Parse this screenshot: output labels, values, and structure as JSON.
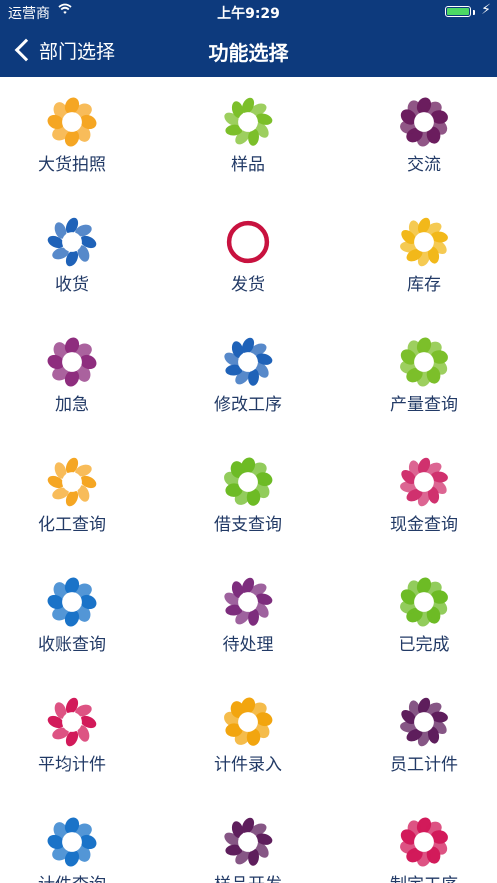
{
  "status_bar": {
    "carrier": "运营商",
    "time": "上午9:29",
    "battery_percent": 100
  },
  "nav": {
    "back_label": "部门选择",
    "title": "功能选择"
  },
  "icon_colors": {
    "orange": "#f5a623",
    "green": "#7cbf2a",
    "purple": "#6b1d5e",
    "blue": "#1f62b8",
    "crimson": "#c8123f",
    "gold": "#f2b81a",
    "magenta": "#8e2d7e",
    "pink": "#d0316e",
    "sky": "#1a73c8",
    "grape": "#7d2d7d",
    "lime": "#6dbb25",
    "rose": "#d21a5a",
    "amber": "#f2a50f",
    "plum": "#5e1e5c"
  },
  "items": [
    {
      "label": "大货拍照",
      "icon": "large-goods-photo-icon",
      "color": "orange"
    },
    {
      "label": "样品",
      "icon": "sample-icon",
      "color": "green"
    },
    {
      "label": "交流",
      "icon": "communicate-icon",
      "color": "purple"
    },
    {
      "label": "收货",
      "icon": "receive-goods-icon",
      "color": "blue"
    },
    {
      "label": "发货",
      "icon": "ship-goods-icon",
      "color": "crimson"
    },
    {
      "label": "库存",
      "icon": "inventory-icon",
      "color": "gold"
    },
    {
      "label": "加急",
      "icon": "urgent-icon",
      "color": "magenta"
    },
    {
      "label": "修改工序",
      "icon": "modify-process-icon",
      "color": "blue"
    },
    {
      "label": "产量查询",
      "icon": "output-query-icon",
      "color": "green"
    },
    {
      "label": "化工查询",
      "icon": "chemical-query-icon",
      "color": "orange"
    },
    {
      "label": "借支查询",
      "icon": "advance-query-icon",
      "color": "lime"
    },
    {
      "label": "现金查询",
      "icon": "cash-query-icon",
      "color": "pink"
    },
    {
      "label": "收账查询",
      "icon": "receivable-query-icon",
      "color": "sky"
    },
    {
      "label": "待处理",
      "icon": "pending-icon",
      "color": "grape"
    },
    {
      "label": "已完成",
      "icon": "completed-icon",
      "color": "lime"
    },
    {
      "label": "平均计件",
      "icon": "average-piecework-icon",
      "color": "rose"
    },
    {
      "label": "计件录入",
      "icon": "piecework-entry-icon",
      "color": "amber"
    },
    {
      "label": "员工计件",
      "icon": "employee-piecework-icon",
      "color": "plum"
    },
    {
      "label": "计件查询",
      "icon": "piecework-query-icon",
      "color": "sky"
    },
    {
      "label": "样品开发",
      "icon": "sample-development-icon",
      "color": "plum"
    },
    {
      "label": "制定工序",
      "icon": "define-process-icon",
      "color": "rose"
    }
  ]
}
